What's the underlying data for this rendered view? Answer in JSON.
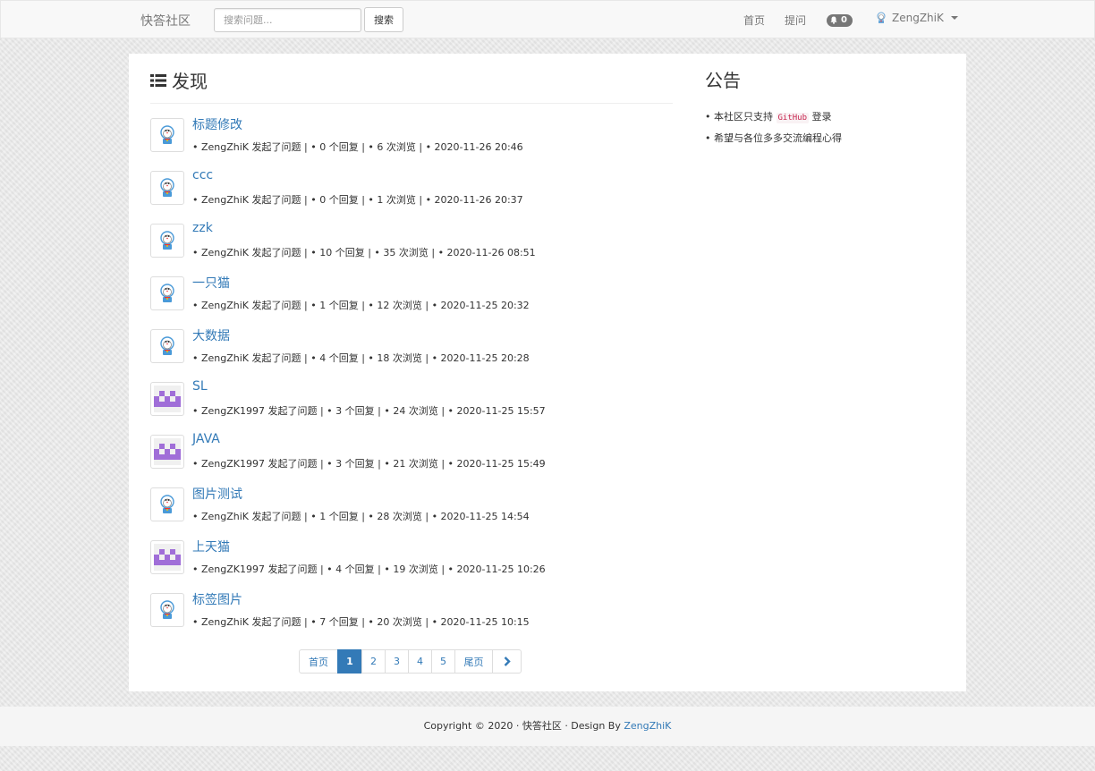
{
  "navbar": {
    "brand": "快答社区",
    "search_placeholder": "搜索问题...",
    "search_button": "搜索",
    "home": "首页",
    "ask": "提问",
    "notification_count": "0",
    "username": "ZengZhiK"
  },
  "main": {
    "title": "发现",
    "questions": [
      {
        "title": "标题修改",
        "meta": "• ZengZhiK 发起了问题 | • 0 个回复 | • 6 次浏览 | • 2020-11-26 20:46",
        "avatar": "doraemon-avatar"
      },
      {
        "title": "ccc",
        "meta": "• ZengZhiK 发起了问题 | • 0 个回复 | • 1 次浏览 | • 2020-11-26 20:37",
        "avatar": "doraemon-avatar"
      },
      {
        "title": "zzk",
        "meta": "• ZengZhiK 发起了问题 | • 10 个回复 | • 35 次浏览 | • 2020-11-26 08:51",
        "avatar": "doraemon-avatar"
      },
      {
        "title": "一只猫",
        "meta": "• ZengZhiK 发起了问题 | • 1 个回复 | • 12 次浏览 | • 2020-11-25 20:32",
        "avatar": "doraemon-avatar"
      },
      {
        "title": "大数据",
        "meta": "• ZengZhiK 发起了问题 | • 4 个回复 | • 18 次浏览 | • 2020-11-25 20:28",
        "avatar": "doraemon-avatar"
      },
      {
        "title": "SL",
        "meta": "• ZengZK1997 发起了问题 | • 3 个回复 | • 24 次浏览 | • 2020-11-25 15:57",
        "avatar": "identicon-avatar"
      },
      {
        "title": "JAVA",
        "meta": "• ZengZK1997 发起了问题 | • 3 个回复 | • 21 次浏览 | • 2020-11-25 15:49",
        "avatar": "identicon-avatar"
      },
      {
        "title": "图片测试",
        "meta": "• ZengZhiK 发起了问题 | • 1 个回复 | • 28 次浏览 | • 2020-11-25 14:54",
        "avatar": "doraemon-avatar"
      },
      {
        "title": "上天猫",
        "meta": "• ZengZK1997 发起了问题 | • 4 个回复 | • 19 次浏览 | • 2020-11-25 10:26",
        "avatar": "identicon-avatar"
      },
      {
        "title": "标签图片",
        "meta": "• ZengZhiK 发起了问题 | • 7 个回复 | • 20 次浏览 | • 2020-11-25 10:15",
        "avatar": "doraemon-avatar"
      }
    ],
    "pagination": {
      "first": "首页",
      "pages": [
        "1",
        "2",
        "3",
        "4",
        "5"
      ],
      "active": "1",
      "last": "尾页",
      "next_icon": "chevron-right-icon"
    }
  },
  "sidebar": {
    "title": "公告",
    "notice1_prefix": "• 本社区只支持",
    "notice1_code": "GitHub",
    "notice1_suffix": "登录",
    "notice2": "• 希望与各位多多交流编程心得"
  },
  "footer": {
    "text": "Copyright © 2020 · 快答社区 · Design By",
    "author": "ZengZhiK"
  },
  "colors": {
    "link": "#337ab7",
    "navbar_bg": "#f8f8f8",
    "page_bg": "#e9e9e9",
    "identicon": "#a06ed8"
  }
}
